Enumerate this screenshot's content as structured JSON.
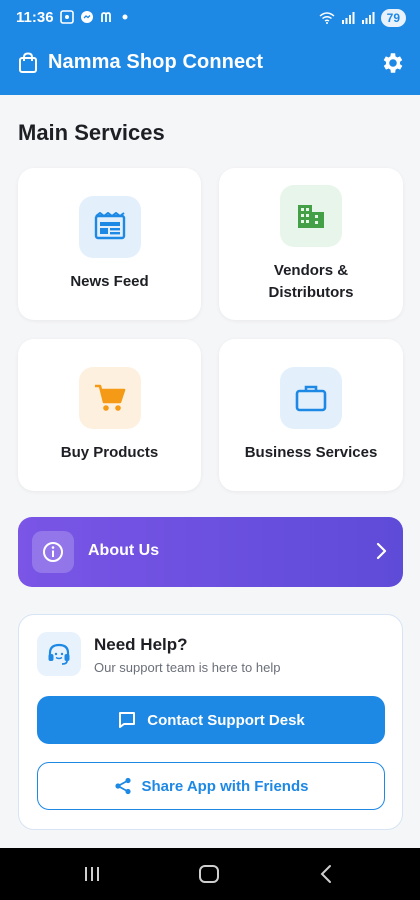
{
  "status": {
    "time": "11:36",
    "battery": "79"
  },
  "appbar": {
    "title": "Namma Shop Connect"
  },
  "main": {
    "section_title": "Main Services",
    "services": [
      {
        "label": "News Feed"
      },
      {
        "label_line1": "Vendors &",
        "label_line2": "Distributors"
      },
      {
        "label": "Buy Products"
      },
      {
        "label": "Business Services"
      }
    ]
  },
  "about": {
    "label": "About Us"
  },
  "help": {
    "title": "Need Help?",
    "subtitle": "Our support team is here to help",
    "contact_label": "Contact Support Desk",
    "share_label": "Share App with Friends"
  },
  "colors": {
    "primary": "#1e88e5",
    "about_gradient_start": "#7a55e6",
    "about_gradient_end": "#5e4bd8"
  },
  "icons": {
    "news": "newspaper-icon",
    "vendors": "building-icon",
    "buy": "cart-icon",
    "business": "briefcase-icon",
    "about": "info-icon",
    "help": "headset-icon",
    "contact": "chat-icon",
    "share": "share-icon"
  }
}
